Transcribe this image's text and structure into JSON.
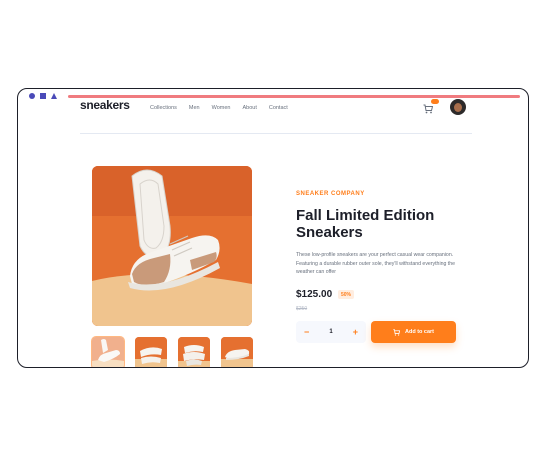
{
  "brand": {
    "logo": "sneakers"
  },
  "nav": {
    "links": [
      "Collections",
      "Men",
      "Women",
      "About",
      "Contact"
    ]
  },
  "product": {
    "company": "SNEAKER COMPANY",
    "title": "Fall Limited Edition Sneakers",
    "description": "These low-profile sneakers are your perfect casual wear companion. Featuring a durable rubber outer sole, they'll withstand everything the weather can offer",
    "price": "$125.00",
    "discount": "50%",
    "old_price": "$250",
    "quantity": "1",
    "minus": "−",
    "plus": "+",
    "add_to_cart": "Add to cart"
  },
  "colors": {
    "accent": "#ff7e1b",
    "dark": "#1d1f29",
    "muted": "#68707d",
    "image_bg": "#e57030",
    "window_dots": "#4a4ab8",
    "url_bar": "#f07b7f"
  },
  "icons": [
    "window-circle-icon",
    "window-square-icon",
    "window-triangle-icon",
    "cart-icon",
    "avatar"
  ]
}
